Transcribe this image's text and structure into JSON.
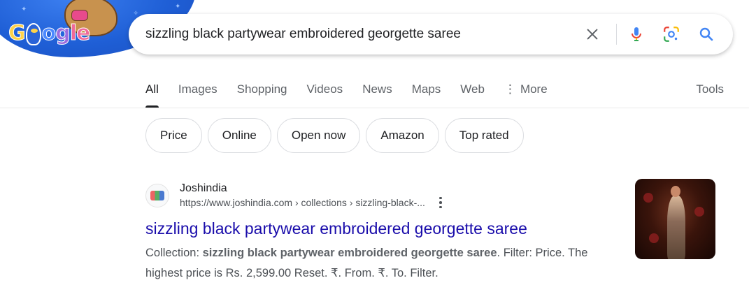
{
  "search": {
    "query": "sizzling black partywear embroidered georgette saree"
  },
  "doodle": {
    "letters": [
      "G",
      "",
      "o",
      "g",
      "l",
      "e"
    ]
  },
  "tabs": [
    {
      "label": "All",
      "active": true
    },
    {
      "label": "Images",
      "active": false
    },
    {
      "label": "Shopping",
      "active": false
    },
    {
      "label": "Videos",
      "active": false
    },
    {
      "label": "News",
      "active": false
    },
    {
      "label": "Maps",
      "active": false
    },
    {
      "label": "Web",
      "active": false
    },
    {
      "label": "More",
      "active": false
    }
  ],
  "tools_label": "Tools",
  "chips": [
    "Price",
    "Online",
    "Open now",
    "Amazon",
    "Top rated"
  ],
  "result": {
    "site_name": "Joshindia",
    "url": "https://www.joshindia.com › collections › sizzling-black-...",
    "title": "sizzling black partywear embroidered georgette saree",
    "snippet_prefix": "Collection: ",
    "snippet_bold": "sizzling black partywear embroidered georgette saree",
    "snippet_suffix": ". Filter: Price. The highest price is Rs. 2,599.00 Reset. ₹. From. ₹. To. Filter."
  },
  "colors": {
    "link": "#1a0dab",
    "text": "#202124",
    "muted": "#4d5156",
    "google_blue": "#4285f4",
    "google_red": "#ea4335",
    "google_yellow": "#fbbc04",
    "google_green": "#34a853"
  },
  "icons": {
    "clear": "close-icon",
    "voice": "microphone-icon",
    "lens": "camera-lens-icon",
    "search": "search-icon",
    "more": "vertical-dots-icon"
  }
}
